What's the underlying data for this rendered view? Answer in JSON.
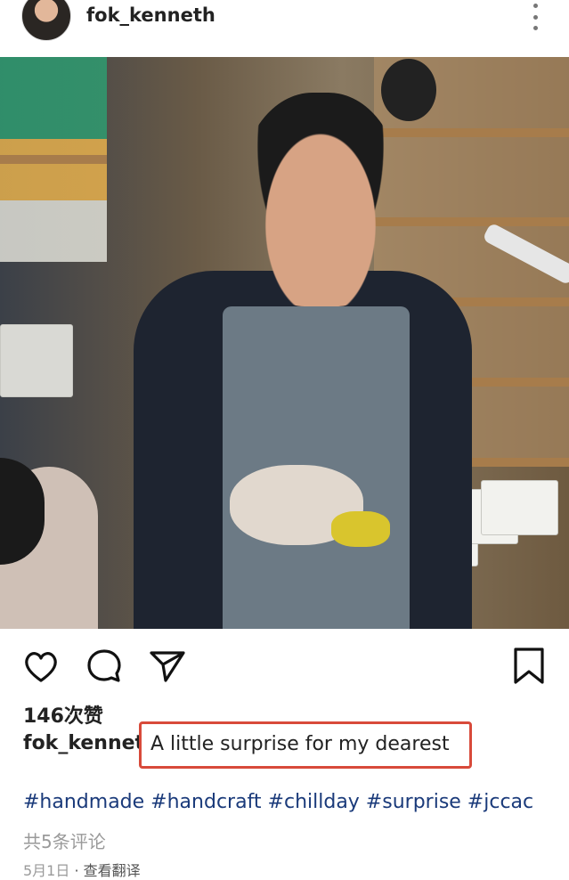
{
  "post": {
    "username": "fok_kenneth",
    "likes": "146次赞",
    "caption_username": "fok_kenneth",
    "caption_text": "A little surprise for my dearest",
    "hashtags": "#handmade #handcraft #chillday #surprise #jccac",
    "comments_link": "共5条评论",
    "date": "5月1日",
    "separator": "·",
    "translate_link": "查看翻译"
  },
  "icons": {
    "more": "more-vertical-icon",
    "like": "heart-icon",
    "comment": "comment-icon",
    "share": "send-icon",
    "save": "bookmark-icon"
  },
  "colors": {
    "highlight_border": "#d84a3a",
    "hashtag": "#1a3a7a",
    "muted": "#9a9a9a"
  }
}
